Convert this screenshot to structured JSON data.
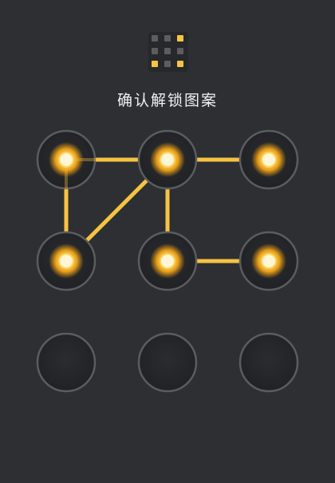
{
  "mini_pattern": {
    "cells": [
      "inactive",
      "inactive",
      "active",
      "inactive",
      "inactive",
      "inactive",
      "active",
      "inactive",
      "active"
    ],
    "colors": {
      "active": "#f6c443",
      "inactive": "#5b5d61"
    }
  },
  "title": "确认解锁图案",
  "lock": {
    "grid_size": 3,
    "selected_sequence": [
      3,
      1,
      4,
      2,
      5,
      6
    ],
    "colors": {
      "line": "#f6c443",
      "node_glow": "#ffb420",
      "node_core": "#fff6d8",
      "ring": "#5a5c60",
      "inactive_fill": "#222428"
    }
  }
}
